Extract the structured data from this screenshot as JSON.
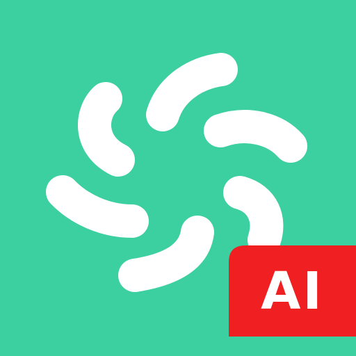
{
  "app_icon": {
    "background_color": "#3ccfa0",
    "petal_color": "#ffffff",
    "icon_name": "pinwheel-swirl-logo-icon",
    "badge": {
      "text": "AI",
      "color": "#f01f22"
    }
  }
}
